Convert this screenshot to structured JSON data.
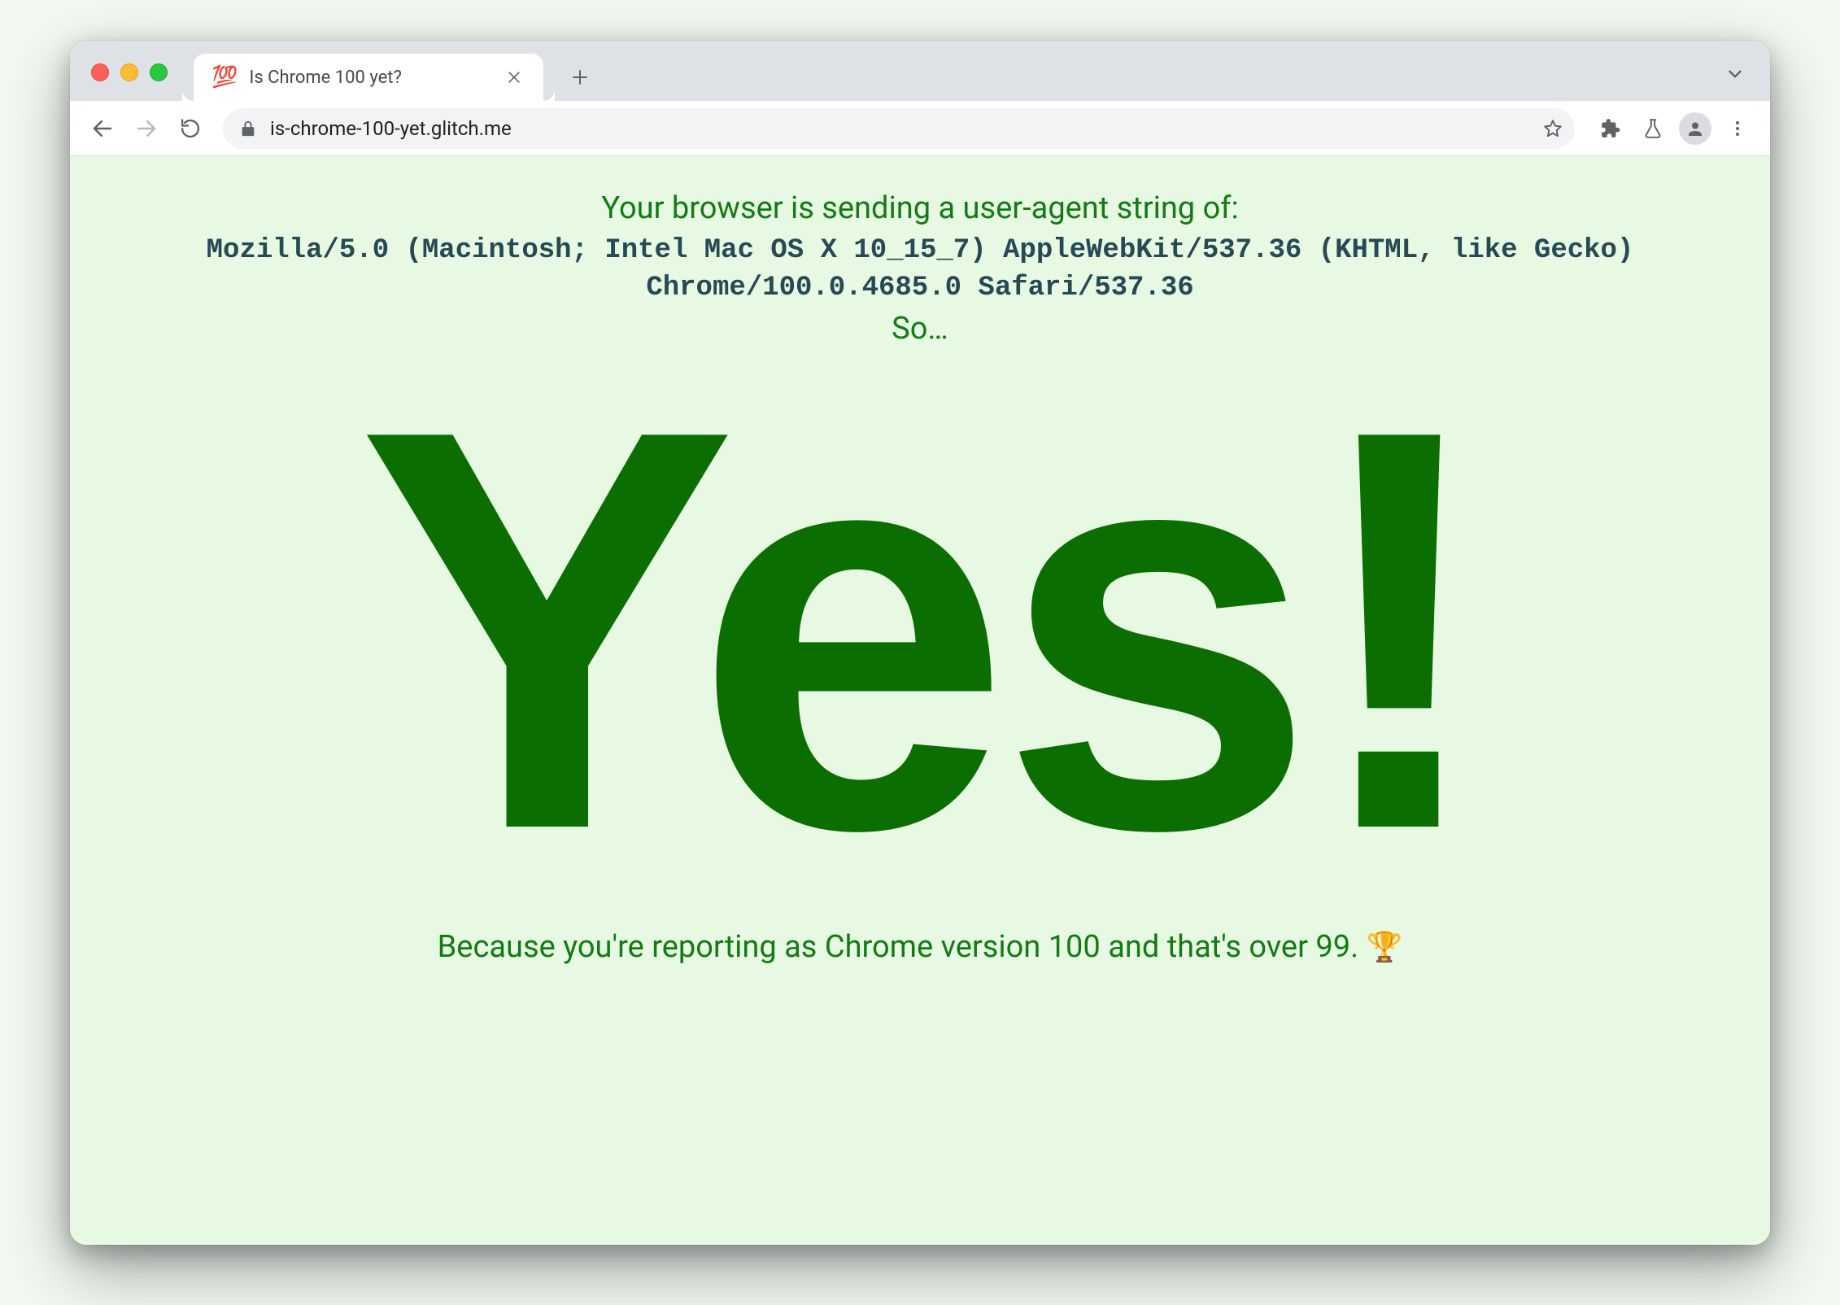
{
  "window": {
    "tab": {
      "favicon": "💯",
      "title": "Is Chrome 100 yet?"
    }
  },
  "toolbar": {
    "url": "is-chrome-100-yet.glitch.me"
  },
  "page": {
    "intro": "Your browser is sending a user-agent string of:",
    "ua": "Mozilla/5.0 (Macintosh; Intel Mac OS X 10_15_7) AppleWebKit/537.36 (KHTML, like Gecko) Chrome/100.0.4685.0 Safari/537.36",
    "so": "So…",
    "answer": "Yes!",
    "reason": "Because you're reporting as Chrome version 100 and that's over 99. ",
    "trophy": "🏆"
  },
  "colors": {
    "pageBg": "#e7f9e3",
    "greenText": "#137b13",
    "darkGreen": "#0b6e00",
    "uaText": "#264a54"
  }
}
